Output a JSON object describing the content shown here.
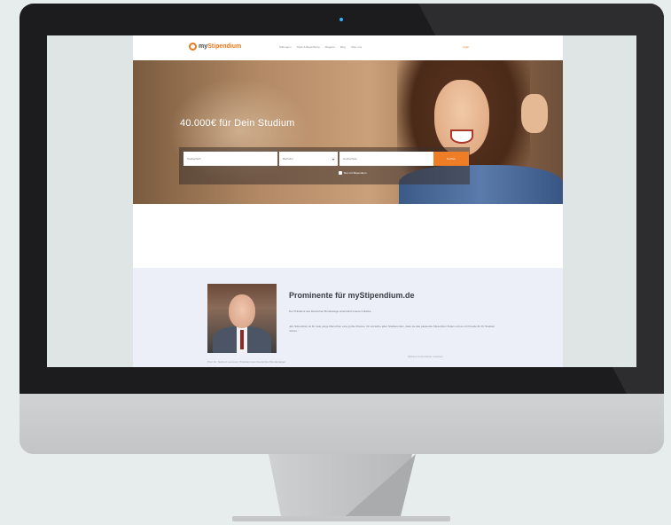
{
  "nav": {
    "logo_prefix": "my",
    "logo_suffix": "Stipendium",
    "links": [
      "Stiftungen",
      "Tipps & Bewerbung",
      "Magazin",
      "Blog",
      "Über uns"
    ],
    "login_label": "Login"
  },
  "hero": {
    "headline": "40.000€ für Dein Studium",
    "search": {
      "field1_placeholder": "Studienfach",
      "field2_value": "Bachelor",
      "field3_placeholder": "Hochschule",
      "button_label": "Suchen",
      "checkbox_label": "Nur mit Stipendium"
    }
  },
  "prominent": {
    "title": "Prominente für myStipendium.de",
    "subtitle": "Der Präsident des Deutschen Bundestags unterstützt unsere Initiative.",
    "body": "„Ein Stipendium ist für viele junge Menschen eine große Chance. Ich wünsche allen Studierenden, dass sie das passende Stipendium finden und es mit Freude für ihr Studium nutzen.“",
    "photo_caption": "Prof. Dr. Norbert Lammert, Präsident des Deutschen Bundestages",
    "more_link": "Weitere Unterstützer ansehen"
  },
  "colors": {
    "accent": "#ee7d26",
    "bezel": "#1c1c1e",
    "promi_bg": "#eceff7"
  },
  "icons": {
    "logo": "orange-ring-icon",
    "select": "chevron-down-icon",
    "checkbox": "checkbox-icon",
    "camera": "camera-dot-icon"
  }
}
